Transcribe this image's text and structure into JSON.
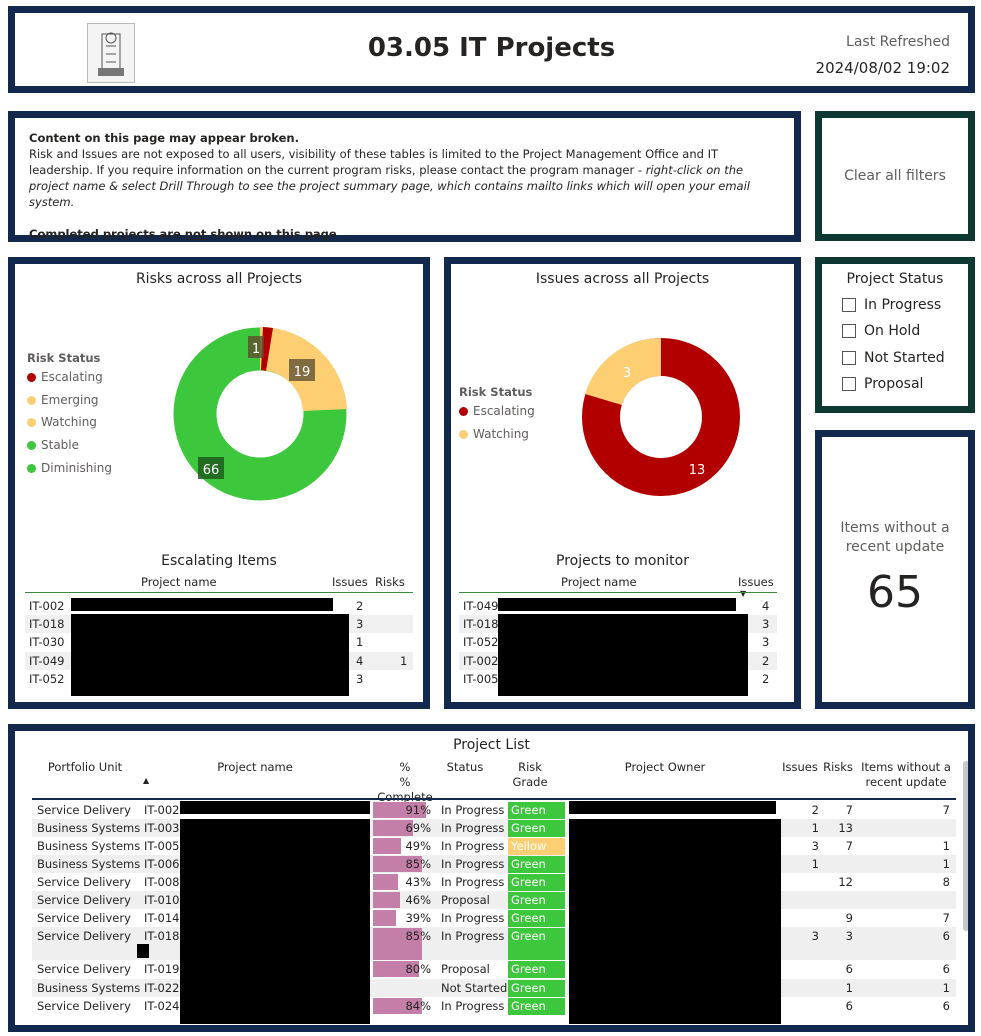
{
  "header": {
    "title": "03.05 IT Projects",
    "last_refreshed_label": "Last Refreshed",
    "last_refreshed_value": "2024/08/02 19:02"
  },
  "note": {
    "line1": "Content on this page may appear broken.",
    "body": "Risk and Issues are not exposed to all users, visibility of these tables is limited to the Project Management Office and IT leadership. If you require information on the current program risks, please contact the program manager - ",
    "body_italic": "right-click on the project name & select Drill Through to see the project summary page, which contains mailto links which will open your email system.",
    "line3_a": "Completed projects are ",
    "line3_b": "not",
    "line3_c": " shown on this page"
  },
  "clear_filters": "Clear all filters",
  "colors": {
    "escalating": "#b20000",
    "emerging": "#fbd074",
    "watching": "#fdcf72",
    "stable": "#3dc73d",
    "diminishing": "#3dc73d",
    "border": "#12294d",
    "bar": "#c47fa8",
    "green": "#3dc73d",
    "yellow": "#fdcf72"
  },
  "risks": {
    "title": "Risks across all Projects",
    "legend_title": "Risk Status",
    "legend": [
      "Escalating",
      "Emerging",
      "Watching",
      "Stable",
      "Diminishing"
    ],
    "labels": {
      "escalating": "1",
      "watching": "19",
      "stable": "66"
    }
  },
  "escalating": {
    "title": "Escalating Items",
    "headers": {
      "name": "Project name",
      "issues": "Issues",
      "risks": "Risks"
    },
    "rows": [
      {
        "id": "IT-002",
        "issues": "2",
        "risks": ""
      },
      {
        "id": "IT-018",
        "issues": "3",
        "risks": ""
      },
      {
        "id": "IT-030",
        "issues": "1",
        "risks": ""
      },
      {
        "id": "IT-049",
        "issues": "4",
        "risks": "1"
      },
      {
        "id": "IT-052",
        "issues": "3",
        "risks": ""
      }
    ]
  },
  "issues": {
    "title": "Issues across all Projects",
    "legend_title": "Risk Status",
    "legend": [
      "Escalating",
      "Watching"
    ],
    "labels": {
      "watching": "3",
      "escalating": "13"
    }
  },
  "monitor": {
    "title": "Projects to monitor",
    "headers": {
      "name": "Project name",
      "issues": "Issues"
    },
    "rows": [
      {
        "id": "IT-049",
        "issues": "4"
      },
      {
        "id": "IT-018",
        "issues": "3"
      },
      {
        "id": "IT-052",
        "issues": "3"
      },
      {
        "id": "IT-002",
        "issues": "2"
      },
      {
        "id": "IT-005",
        "issues": "2"
      }
    ]
  },
  "status_slicer": {
    "title": "Project Status",
    "options": [
      "In Progress",
      "On Hold",
      "Not Started",
      "Proposal"
    ]
  },
  "card": {
    "label": "Items without a recent update",
    "value": "65"
  },
  "project_list": {
    "title": "Project List",
    "headers": {
      "unit": "Portfolio Unit",
      "name": "Project name",
      "complete": "% Complete",
      "status": "Status",
      "grade": "Risk Grade",
      "owner": "Project Owner",
      "issues": "Issues",
      "risks": "Risks",
      "noupdate": "Items without a recent update"
    },
    "rows": [
      {
        "unit": "Service Delivery",
        "id": "IT-002",
        "pct": "91%",
        "status": "In Progress",
        "grade": "Green",
        "issues": "2",
        "risks": "7",
        "noupd": "7"
      },
      {
        "unit": "Business Systems",
        "id": "IT-003",
        "pct": "69%",
        "status": "In Progress",
        "grade": "Green",
        "issues": "1",
        "risks": "13",
        "noupd": ""
      },
      {
        "unit": "Business Systems",
        "id": "IT-005",
        "pct": "49%",
        "status": "In Progress",
        "grade": "Yellow",
        "issues": "3",
        "risks": "7",
        "noupd": "1"
      },
      {
        "unit": "Business Systems",
        "id": "IT-006",
        "pct": "85%",
        "status": "In Progress",
        "grade": "Green",
        "issues": "1",
        "risks": "",
        "noupd": "1"
      },
      {
        "unit": "Service Delivery",
        "id": "IT-008",
        "pct": "43%",
        "status": "In Progress",
        "grade": "Green",
        "issues": "",
        "risks": "12",
        "noupd": "8"
      },
      {
        "unit": "Service Delivery",
        "id": "IT-010",
        "pct": "46%",
        "status": "Proposal",
        "grade": "Green",
        "issues": "",
        "risks": "",
        "noupd": ""
      },
      {
        "unit": "Service Delivery",
        "id": "IT-014",
        "pct": "39%",
        "status": "In Progress",
        "grade": "Green",
        "issues": "",
        "risks": "9",
        "noupd": "7"
      },
      {
        "unit": "Service Delivery",
        "id": "IT-018",
        "pct": "85%",
        "status": "In Progress",
        "grade": "Green",
        "issues": "3",
        "risks": "3",
        "noupd": "6"
      },
      {
        "unit": "Service Delivery",
        "id": "IT-019",
        "pct": "80%",
        "status": "Proposal",
        "grade": "Green",
        "issues": "",
        "risks": "6",
        "noupd": "6"
      },
      {
        "unit": "Business Systems",
        "id": "IT-022",
        "pct": "",
        "status": "Not Started",
        "grade": "Green",
        "issues": "",
        "risks": "1",
        "noupd": "1"
      },
      {
        "unit": "Service Delivery",
        "id": "IT-024",
        "pct": "84%",
        "status": "In Progress",
        "grade": "Green",
        "issues": "",
        "risks": "6",
        "noupd": "6"
      }
    ]
  }
}
